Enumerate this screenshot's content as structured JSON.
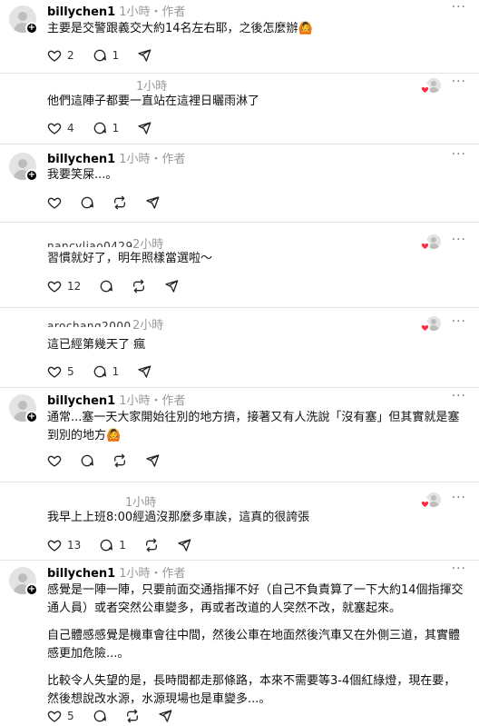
{
  "posts": [
    {
      "username": "billychen1",
      "meta": "1小時・作者",
      "text": [
        "主要是交警跟義交大約14名左右耶，之後怎麼辦🙆"
      ],
      "likes": "2",
      "replies": "1"
    },
    {
      "meta": "1小時",
      "text": [
        "他們這陣子都要一直站在這裡日曬雨淋了"
      ],
      "likes": "4",
      "replies": "1"
    },
    {
      "username": "billychen1",
      "meta": "1小時・作者",
      "text": [
        "我要笑屎...。"
      ]
    },
    {
      "blurred_name": "nancyliao0429",
      "meta": "2小時",
      "text": [
        "習慣就好了，明年照樣當選啦～"
      ],
      "likes": "12"
    },
    {
      "blurred_name": "arochang2000",
      "meta": "2小時",
      "text": [
        "這已經第幾天了 瘋"
      ],
      "likes": "5",
      "replies": "1"
    },
    {
      "username": "billychen1",
      "meta": "1小時・作者",
      "text": [
        "通常...塞一天大家開始往別的地方擠，接著又有人洗說「沒有塞」但其實就是塞到別的地方🙆"
      ]
    },
    {
      "meta": "1小時",
      "text": [
        "我早上上班8:00經過沒那麼多車誒，這真的很誇張"
      ],
      "likes": "13",
      "replies": "1"
    },
    {
      "username": "billychen1",
      "meta": "1小時・作者",
      "text": [
        "感覺是一陣一陣，只要前面交通指揮不好（自己不負責算了一下大約14個指揮交通人員）或者突然公車變多，再或者改道的人突然不改，就塞起來。",
        "自己體感感覺是機車會往中間，然後公車在地面然後汽車又在外側三道，其實體感更加危險...。",
        "比較令人失望的是，長時間都走那條路，本來不需要等3-4個紅綠燈，現在要，然後想說改水源，水源現場也是車變多...。"
      ],
      "likes": "5"
    }
  ],
  "more_icon": "more-icon",
  "colors": {
    "liked_heart": "#ff3040",
    "meta": "#999999",
    "divider": "#e5e5e5"
  }
}
